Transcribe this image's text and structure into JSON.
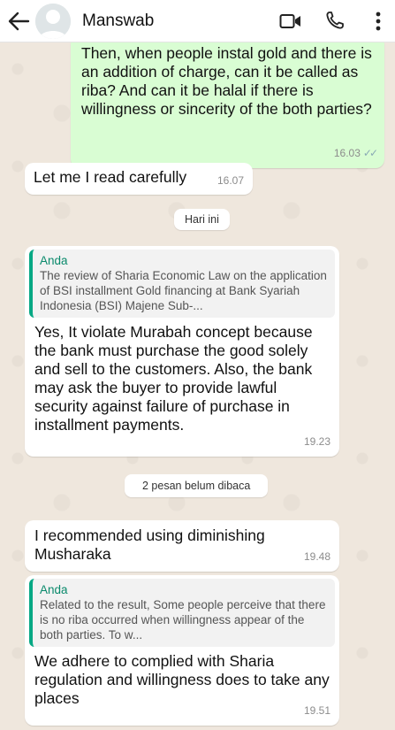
{
  "header": {
    "contact_name": "Manswab"
  },
  "messages": {
    "m1": {
      "text": "Then, when people instal gold and there is an addition of charge, can it be called as riba? And can it be halal if there is willingness or sincerity of the both parties?",
      "time": "16.03"
    },
    "m2": {
      "text": "Let me I read carefully",
      "time": "16.07"
    },
    "date_today": "Hari ini",
    "m3": {
      "quote_author": "Anda",
      "quote_text": "The review of Sharia Economic Law on the application of BSI installment Gold financing at Bank Syariah Indonesia (BSI) Majene Sub-...",
      "text": "Yes, It violate Murabah concept because the bank must purchase the good solely and sell to the customers. Also, the bank may ask the buyer to provide lawful security against failure of purchase in installment payments.",
      "time": "19.23"
    },
    "unread_banner": "2 pesan belum dibaca",
    "m4": {
      "text": "I recommended using diminishing Musharaka",
      "time": "19.48"
    },
    "m5": {
      "quote_author": "Anda",
      "quote_text": "Related to the result, Some people perceive that there is no riba occurred when willingness appear of the both parties. To w...",
      "text": "We adhere to complied with Sharia regulation and willingness does to take any places",
      "time": "19.51"
    }
  },
  "colors": {
    "outgoing_bubble": "#d9fdd3",
    "incoming_bubble": "#ffffff",
    "chat_background": "#efe7dd",
    "quote_accent": "#06a884",
    "read_ticks": "#8aaab5"
  },
  "icons": [
    "back-arrow-icon",
    "avatar-placeholder",
    "video-call-icon",
    "phone-icon",
    "more-options-icon",
    "read-receipt-icon"
  ]
}
